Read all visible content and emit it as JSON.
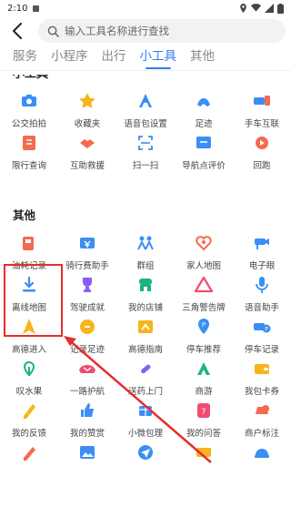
{
  "status": {
    "time": "2:10"
  },
  "search": {
    "placeholder": "输入工具名称进行查找"
  },
  "tabs": [
    {
      "label": "服务"
    },
    {
      "label": "小程序"
    },
    {
      "label": "出行"
    },
    {
      "label": "小工具"
    },
    {
      "label": "其他"
    }
  ],
  "sections": {
    "top_partial": "小工具",
    "other": "其他"
  },
  "colors": {
    "accent": "#2f7cf6",
    "highlight": "#e52d2d"
  },
  "top_grid": [
    {
      "label": "公交拍拍",
      "icon": "camera-icon"
    },
    {
      "label": "收藏夹",
      "icon": "star-icon"
    },
    {
      "label": "语音包设置",
      "icon": "voice-pack-icon"
    },
    {
      "label": "足迹",
      "icon": "footprint-icon"
    },
    {
      "label": "手车互联",
      "icon": "car-phone-icon"
    },
    {
      "label": "限行查询",
      "icon": "restriction-icon"
    },
    {
      "label": "互助救援",
      "icon": "handshake-icon"
    },
    {
      "label": "扫一扫",
      "icon": "scan-icon"
    },
    {
      "label": "导航点评价",
      "icon": "rating-icon"
    },
    {
      "label": "回跑",
      "icon": "replay-icon"
    }
  ],
  "other_grid": [
    {
      "label": "油耗记录",
      "icon": "fuel-icon"
    },
    {
      "label": "骑行费助手",
      "icon": "cost-icon"
    },
    {
      "label": "群组",
      "icon": "group-icon"
    },
    {
      "label": "家人地图",
      "icon": "family-map-icon"
    },
    {
      "label": "电子眼",
      "icon": "camera-eye-icon"
    },
    {
      "label": "离线地图",
      "icon": "download-icon"
    },
    {
      "label": "驾驶成就",
      "icon": "trophy-icon"
    },
    {
      "label": "我的店铺",
      "icon": "shop-icon"
    },
    {
      "label": "三角警告牌",
      "icon": "warning-triangle-icon"
    },
    {
      "label": "语音助手",
      "icon": "microphone-icon"
    },
    {
      "label": "高德进入",
      "icon": "gaode-in-icon"
    },
    {
      "label": "记录足迹",
      "icon": "record-icon"
    },
    {
      "label": "高德指南",
      "icon": "guide-icon"
    },
    {
      "label": "停车推荐",
      "icon": "parking-pin-icon"
    },
    {
      "label": "停车记录",
      "icon": "parking-record-icon"
    },
    {
      "label": "叹水果",
      "icon": "fruit-icon"
    },
    {
      "label": "一路护航",
      "icon": "escort-icon"
    },
    {
      "label": "送药上门",
      "icon": "medicine-icon"
    },
    {
      "label": "商游",
      "icon": "travel-icon"
    },
    {
      "label": "我包卡券",
      "icon": "wallet-icon"
    },
    {
      "label": "我的反馈",
      "icon": "feedback-icon"
    },
    {
      "label": "我的赞赏",
      "icon": "thumb-up-icon"
    },
    {
      "label": "小微包理",
      "icon": "package-icon"
    },
    {
      "label": "我的问答",
      "icon": "qa-icon"
    },
    {
      "label": "商户标注",
      "icon": "merchant-icon"
    },
    {
      "label": "",
      "icon": "pen-icon"
    },
    {
      "label": "",
      "icon": "image-icon"
    },
    {
      "label": "",
      "icon": "send-icon"
    },
    {
      "label": "",
      "icon": "ticket-icon"
    },
    {
      "label": "",
      "icon": "helmet-icon"
    }
  ]
}
